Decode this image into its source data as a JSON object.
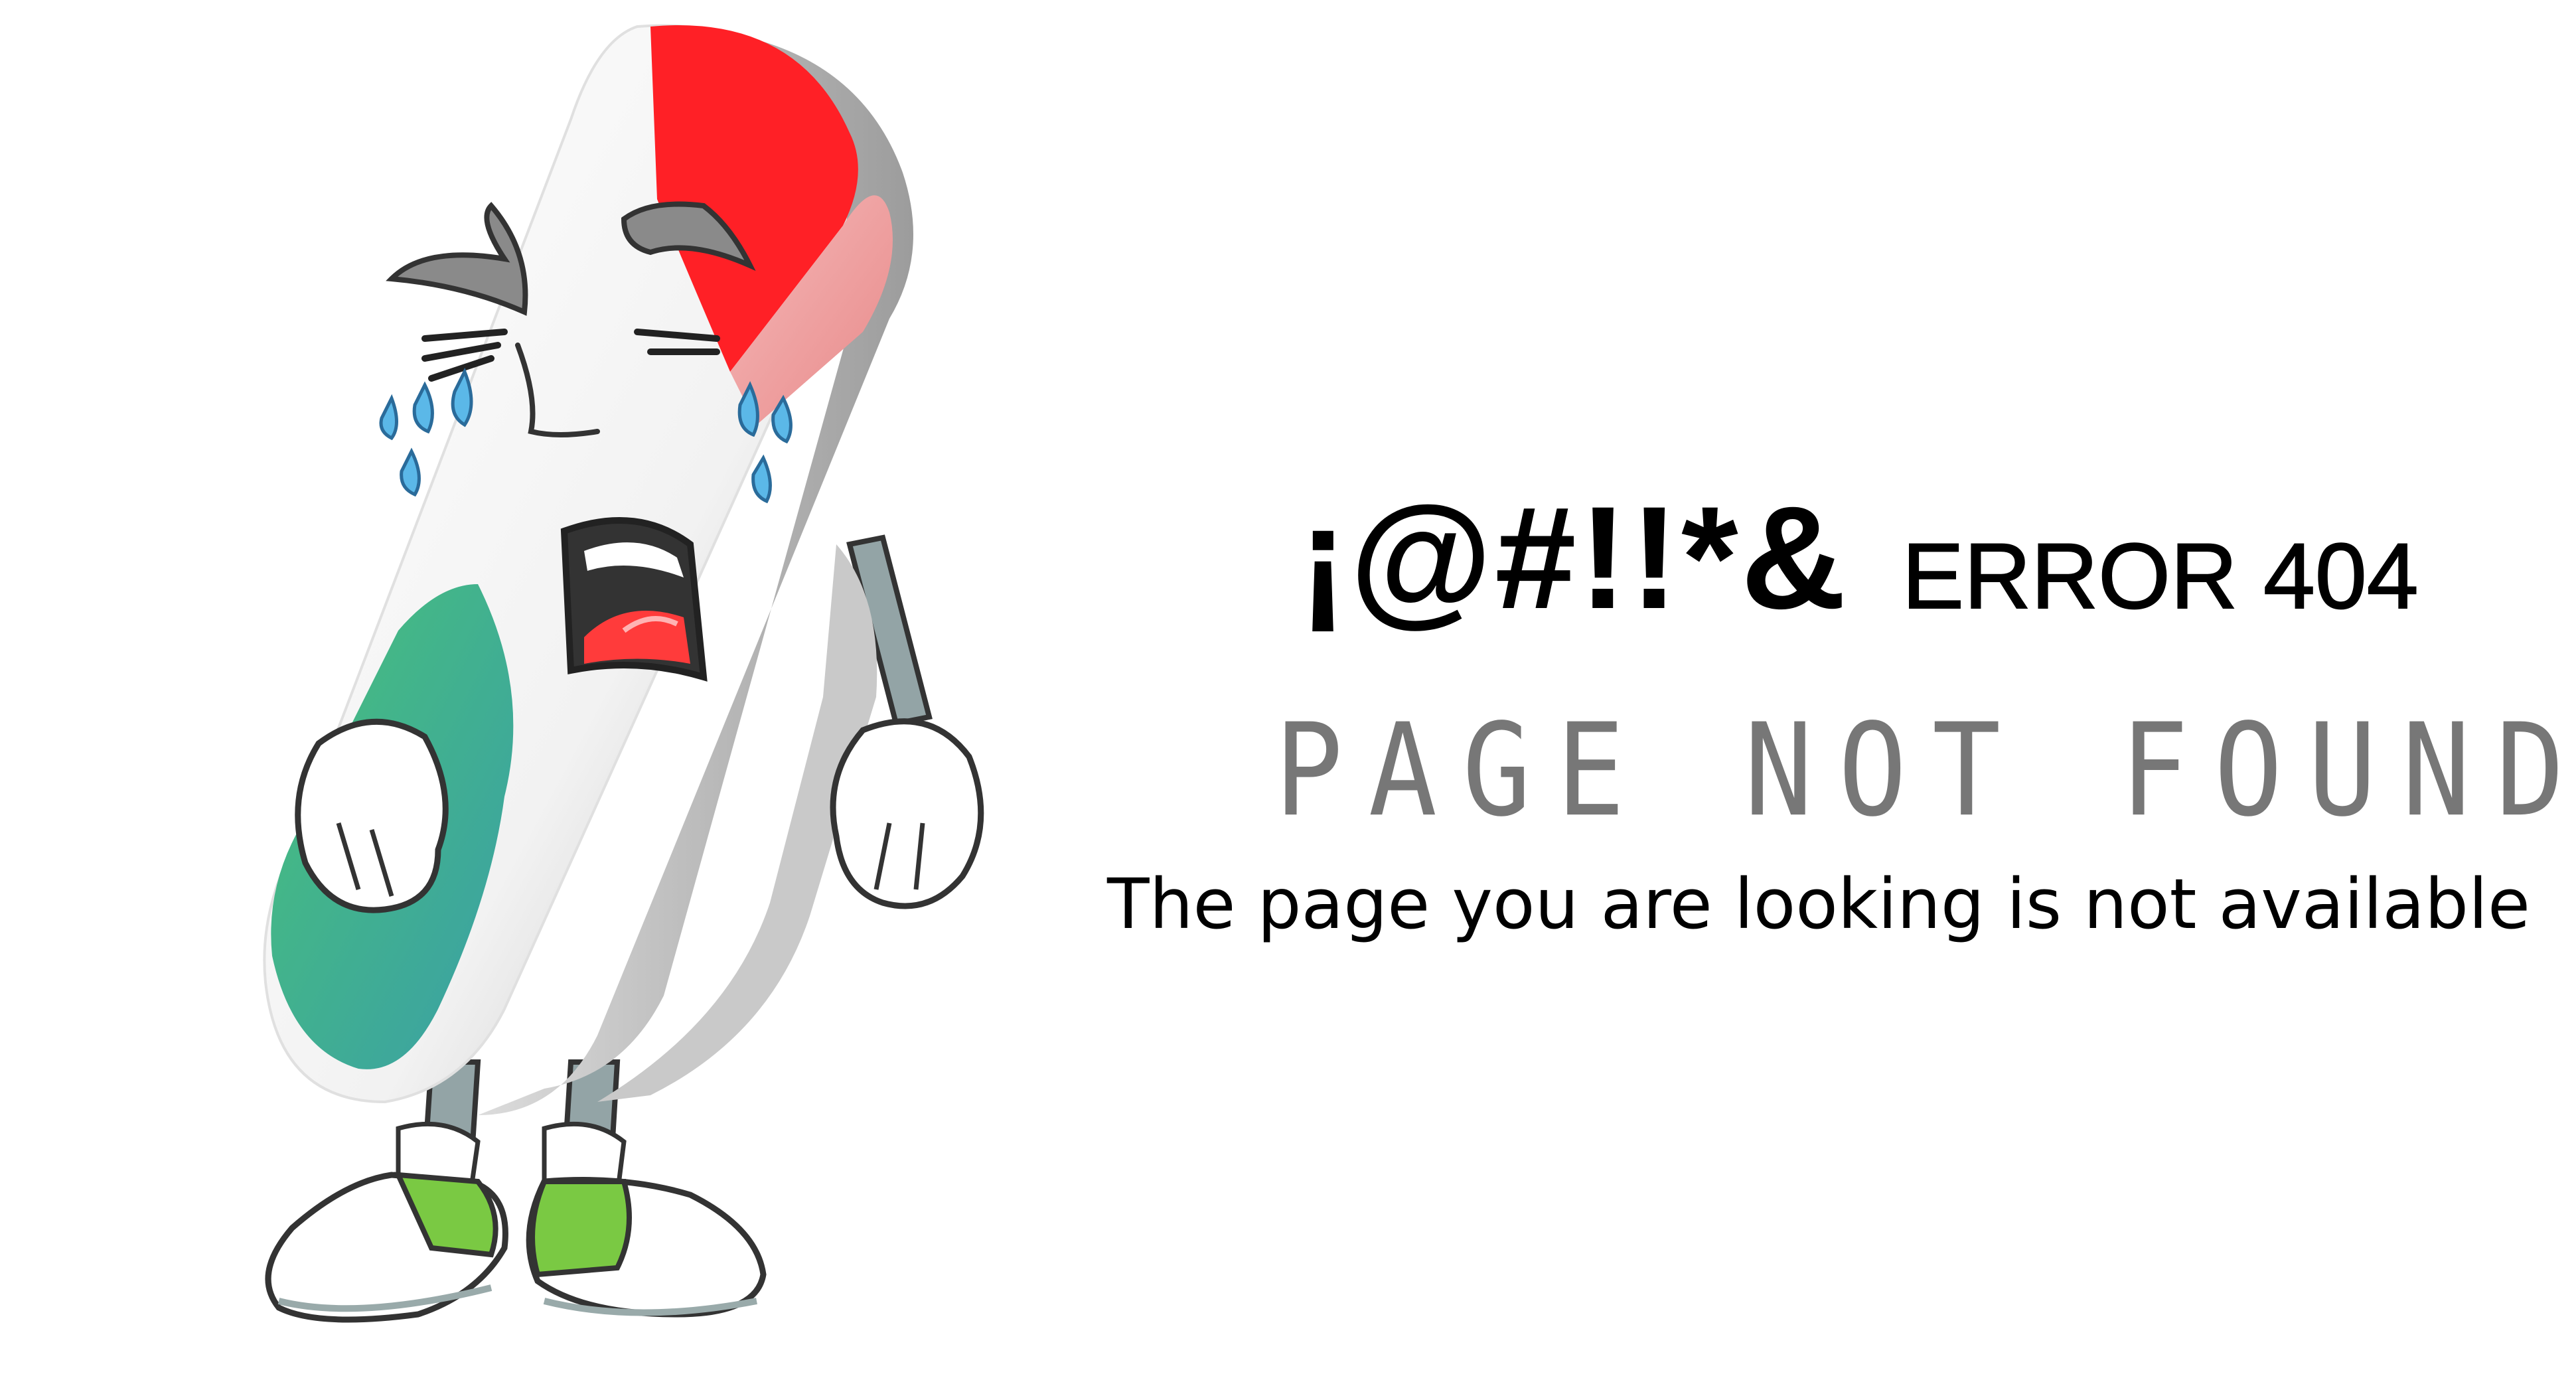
{
  "headline": {
    "symbols": "¡@#!!*&",
    "error_code": "ERROR 404"
  },
  "subtitle": "PAGE NOT FOUND",
  "message": "The page you are looking is not available",
  "mascot": {
    "icon": "crying-pill-mascot",
    "colors": {
      "red": "#ff2026",
      "green": "#4fbf7a",
      "teal": "#3fa7a0",
      "shoe_green": "#7ac943",
      "tear_blue": "#5bb8e8",
      "limb_gray": "#93a4a6"
    }
  }
}
